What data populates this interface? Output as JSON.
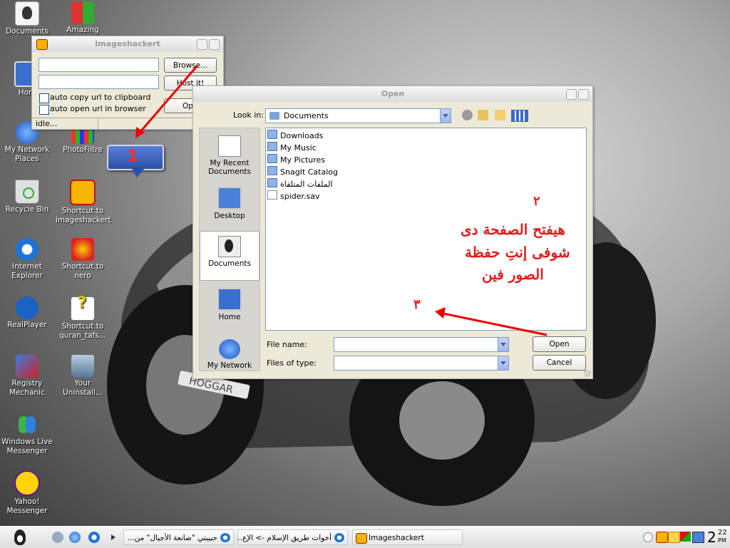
{
  "desktop": {
    "icons": [
      {
        "label": "Documents"
      },
      {
        "label": "Amazing"
      },
      {
        "label": "Hom"
      },
      {
        "label": "My Network Places"
      },
      {
        "label": "PhotoFiltre"
      },
      {
        "label": "Recycle Bin"
      },
      {
        "label": "Shortcut to imageshackert"
      },
      {
        "label": "Internet Explorer"
      },
      {
        "label": "Shortcut to nero"
      },
      {
        "label": "RealPlayer"
      },
      {
        "label": "Shortcut to quran_tafs..."
      },
      {
        "label": "Registry Mechanic"
      },
      {
        "label": "Your Uninstall..."
      },
      {
        "label": "Windows Live Messenger"
      },
      {
        "label": "Yahoo! Messenger"
      }
    ],
    "wallpaper_plate": "HOGGAR"
  },
  "imageshack": {
    "title": "Imageshackert",
    "browse_label": "Browse...",
    "host_label": "Host it!",
    "options_label": "Opti",
    "auto_copy_label": "auto copy url to clipboard",
    "auto_open_label": "auto open url in browser",
    "status": "idle..."
  },
  "open_dialog": {
    "title": "Open",
    "look_in_label": "Look in:",
    "look_in_value": "Documents",
    "places": [
      {
        "label": "My Recent Documents"
      },
      {
        "label": "Desktop"
      },
      {
        "label": "Documents"
      },
      {
        "label": "Home"
      },
      {
        "label": "My Network"
      }
    ],
    "files": [
      {
        "name": "Downloads",
        "icon": "folder-icon"
      },
      {
        "name": "My Music",
        "icon": "music-folder-icon"
      },
      {
        "name": "My Pictures",
        "icon": "pictures-folder-icon"
      },
      {
        "name": "SnagIt Catalog",
        "icon": "folder-icon"
      },
      {
        "name": "الملفات المتلقاة",
        "icon": "folder-icon"
      },
      {
        "name": "spider.sav",
        "icon": "file-icon"
      }
    ],
    "filename_label": "File name:",
    "filetype_label": "Files of type:",
    "open_label": "Open",
    "cancel_label": "Cancel"
  },
  "annotations": {
    "callout_1": "1",
    "num_2": "٢",
    "num_3": "٣",
    "arabic_line1": "هيفتح الصفحة دى",
    "arabic_line2": "شوفى إنتِ حفظة",
    "arabic_line3": "الصور فين"
  },
  "taskbar": {
    "tasks": [
      {
        "label": "حبيبتي \"صانعة الأجيال\" من..."
      },
      {
        "label": "أخوات طريق الإسلام -> الإع..."
      },
      {
        "label": "Imageshackert"
      }
    ],
    "clock_time": "2",
    "clock_min": "22",
    "clock_ampm": "PM"
  },
  "colors": {
    "annotation_red": "#e41c1c",
    "callout_blue": "#2c4fa8"
  }
}
